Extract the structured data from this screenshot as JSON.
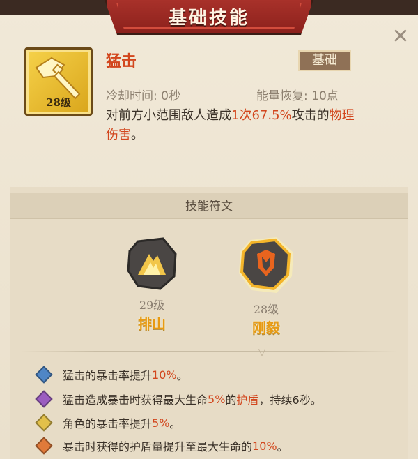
{
  "header": {
    "title": "基础技能",
    "close_icon": "close-icon"
  },
  "skill": {
    "icon": "axe-icon",
    "level": "28级",
    "name": "猛击",
    "badge": "基础",
    "cooldown": "冷却时间: 0秒",
    "energy": "能量恢复: 10点",
    "desc": {
      "p1": "对前方小范围敌人造成",
      "hits": "1次",
      "pct": "67.5%",
      "p2": "攻击的",
      "type_a": "物理",
      "type_b": "伤害",
      "p3": "。"
    }
  },
  "runes": {
    "title": "技能符文",
    "items": [
      {
        "level": "29级",
        "name": "排山",
        "icon": "mountain-rune-icon",
        "selected": false
      },
      {
        "level": "28级",
        "name": "刚毅",
        "icon": "shield-rune-icon",
        "selected": true
      }
    ]
  },
  "effects": [
    {
      "color": "#4f86c6",
      "a": "猛击的暴击率提升",
      "v": "10%",
      "b": "。"
    },
    {
      "color": "#9b5cc0",
      "a": "猛击造成暴击时获得最大生命",
      "v": "5%",
      "b": "的",
      "v2": "护盾",
      "c": "，持续6秒。"
    },
    {
      "color": "#e2c04a",
      "a": "角色的暴击率提升",
      "v": "5%",
      "b": "。"
    },
    {
      "color": "#e07a3a",
      "a": "暴击时获得的护盾量提升至最大生命的",
      "v": "10%",
      "b": "。"
    }
  ]
}
